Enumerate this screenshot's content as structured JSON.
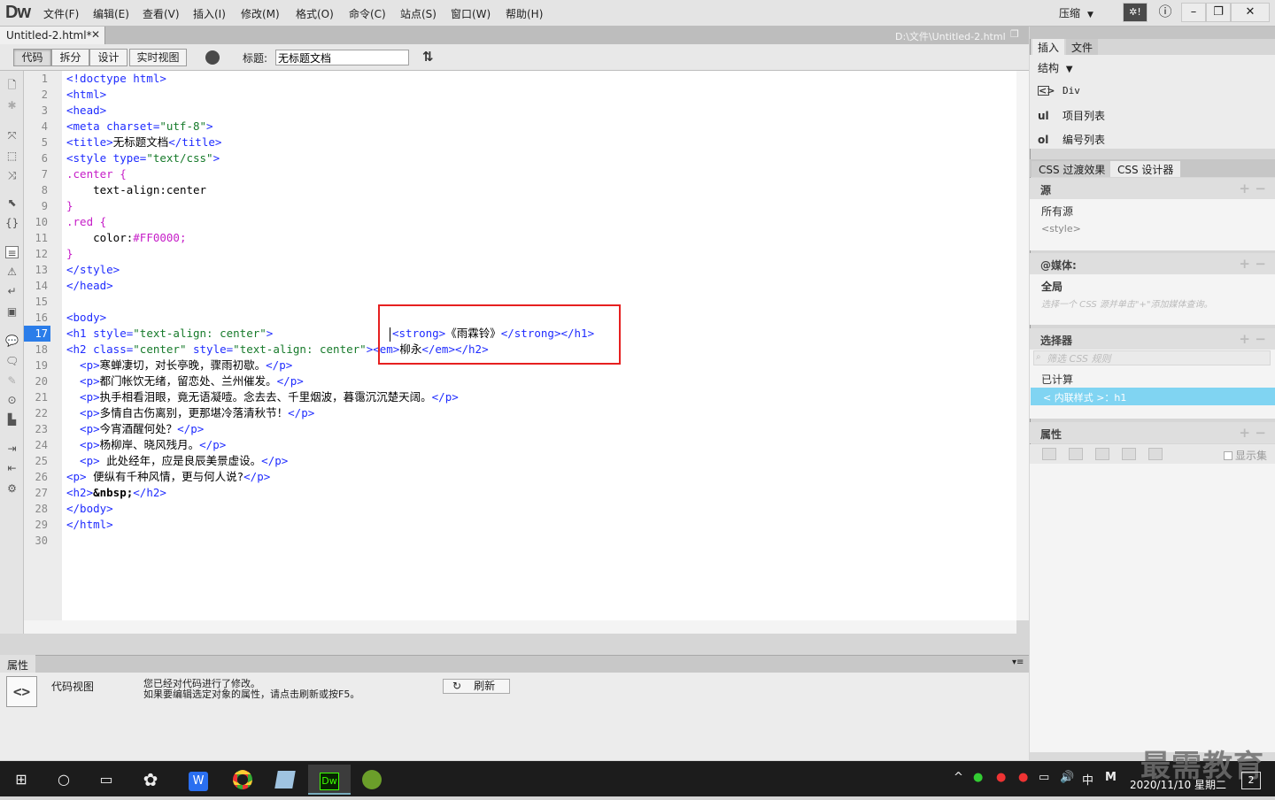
{
  "app": {
    "logo": "Dw"
  },
  "menubar": {
    "items": [
      "文件(F)",
      "编辑(E)",
      "查看(V)",
      "插入(I)",
      "修改(M)",
      "格式(O)",
      "命令(C)",
      "站点(S)",
      "窗口(W)",
      "帮助(H)"
    ],
    "workspace": "压缩"
  },
  "document": {
    "tab_name": "Untitled-2.html*",
    "path": "D:\\文件\\Untitled-2.html"
  },
  "view_buttons": [
    "代码",
    "拆分",
    "设计",
    "实时视图"
  ],
  "title_label": "标题:",
  "title_value": "无标题文档",
  "code": {
    "current_line": 17,
    "line_numbers": [
      "1",
      "2",
      "3",
      "4",
      "5",
      "6",
      "7",
      "8",
      "9",
      "10",
      "11",
      "12",
      "13",
      "14",
      "15",
      "16",
      "17",
      "18",
      "19",
      "20",
      "21",
      "22",
      "23",
      "24",
      "25",
      "26",
      "27",
      "28",
      "29",
      "30"
    ],
    "l1": "<!doctype html>",
    "l2": "<html>",
    "l3": "<head>",
    "l4a": "<meta charset=",
    "l4b": "\"utf-8\"",
    "l4c": ">",
    "l5a": "<title>",
    "l5b": "无标题文档",
    "l5c": "</title>",
    "l6a": "<style type=",
    "l6b": "\"text/css\"",
    "l6c": ">",
    "l7": ".center {",
    "l8a": "    text-align:",
    "l8b": "center",
    "l9": "}",
    "l10": ".red {",
    "l11a": "    color:",
    "l11b": "#FF0000;",
    "l12": "}",
    "l13": "</style>",
    "l14": "</head>",
    "l16": "<body>",
    "l17a": "<h1 style=",
    "l17b": "\"text-align: center\"",
    "l17c": ">",
    "l17d": "<strong>",
    "l17e": "《雨霖铃》",
    "l17f": "</strong></h1>",
    "l18a": "<h2 class=",
    "l18b": "\"center\"",
    "l18c": " style=",
    "l18d": "\"text-align: center\"",
    "l18e": ">",
    "l18f": "<em>",
    "l18g": "柳永",
    "l18h": "</em></h2>",
    "l19a": "  <p>",
    "l19b": "寒蝉凄切，对长亭晚，骤雨初歇。",
    "l19c": "</p>",
    "l20a": "  <p>",
    "l20b": "都门帐饮无绪，留恋处、兰州催发。",
    "l20c": "</p>",
    "l21a": "  <p>",
    "l21b": "执手相看泪眼，竟无语凝噎。念去去、千里烟波，暮霭沉沉楚天阔。",
    "l21c": "</p>",
    "l22a": "  <p>",
    "l22b": "多情自古伤离别，更那堪冷落清秋节！",
    "l22c": "</p>",
    "l23a": "  <p>",
    "l23b": "今宵酒醒何处？",
    "l23c": "</p>",
    "l24a": "  <p>",
    "l24b": "杨柳岸、晓风残月。",
    "l24c": "</p>",
    "l25a": "  <p>",
    "l25b": " 此处经年，应是良辰美景虚设。",
    "l25c": "</p>",
    "l26a": "<p>",
    "l26b": " 便纵有千种风情，更与何人说?",
    "l26c": "</p>",
    "l27a": "<h2>",
    "l27b": "&nbsp;",
    "l27c": "</h2>",
    "l28": "</body>",
    "l29": "</html>"
  },
  "properties": {
    "tab": "属性",
    "icon": "<>",
    "mode": "代码视图",
    "msg1": "您已经对代码进行了修改。",
    "msg2": "如果要编辑选定对象的属性，请点击刷新或按F5。",
    "refresh": "刷新"
  },
  "insert_panel": {
    "tabs": [
      "插入",
      "文件"
    ],
    "category": "结构",
    "items": [
      {
        "icon": "<>",
        "label": "Div"
      },
      {
        "icon": "ul",
        "label": "项目列表"
      },
      {
        "icon": "ol",
        "label": "编号列表"
      }
    ]
  },
  "css_panel": {
    "tabs": [
      "CSS 过渡效果",
      "CSS 设计器"
    ],
    "sources_head": "源",
    "sources": [
      "所有源",
      "<style>"
    ],
    "media_head": "@媒体:",
    "media_global": "全局",
    "media_hint": "选择一个 CSS 源并单击\"+\"添加媒体查询。",
    "selectors_head": "选择器",
    "filter_placeholder": "筛选 CSS 规则",
    "computed": "已计算",
    "selected_rule": "< 内联样式 >：h1",
    "props_head": "属性",
    "show_set": "显示集"
  },
  "taskbar": {
    "ime": "中",
    "date": "2020/11/10 星期二",
    "notif": "2"
  },
  "watermark": "最需教育"
}
